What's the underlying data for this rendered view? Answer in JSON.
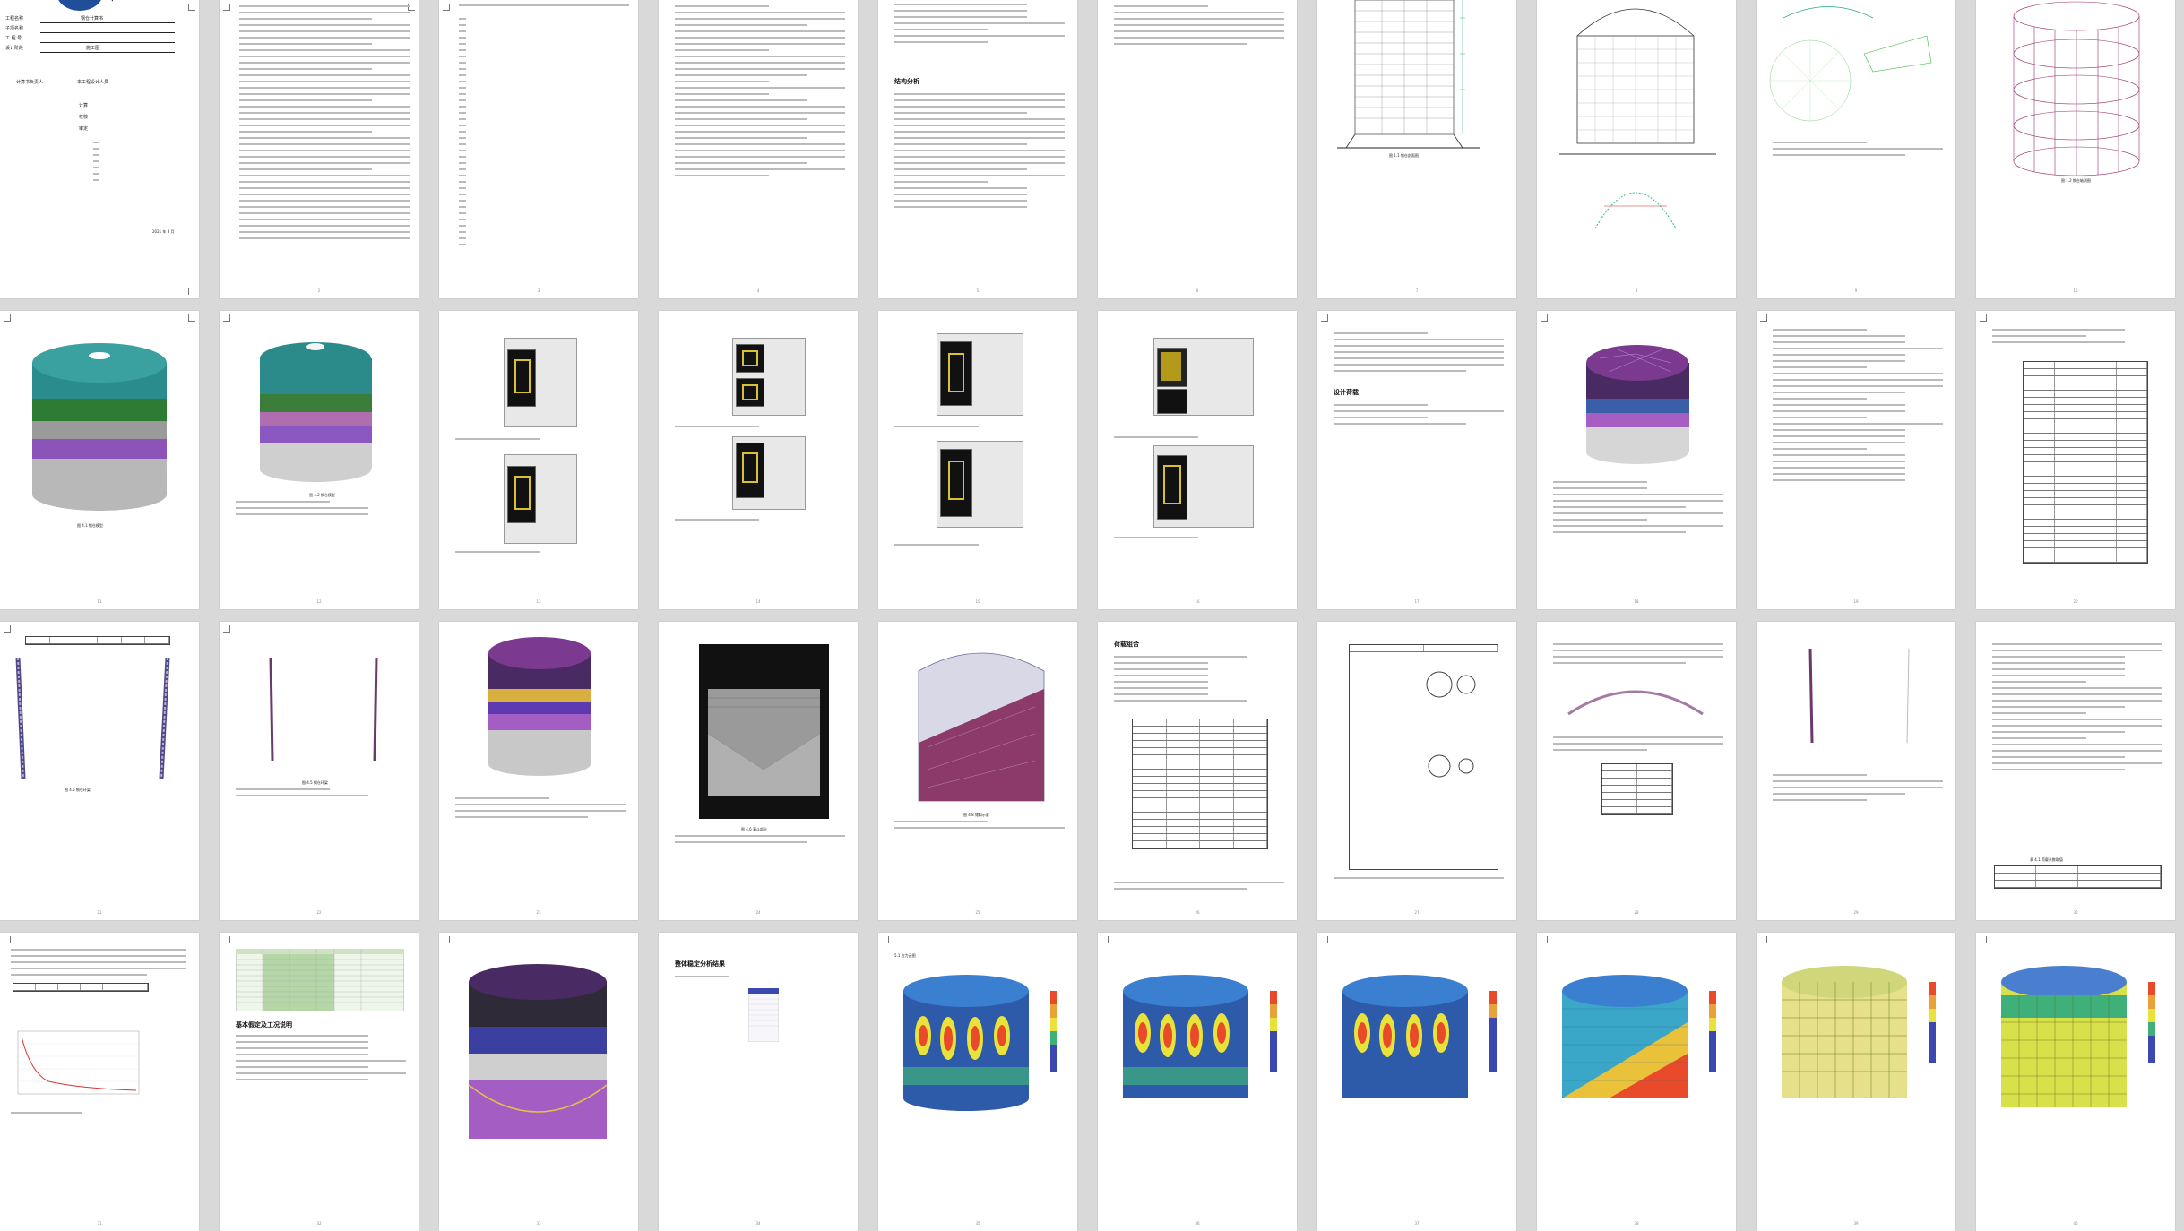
{
  "cover": {
    "logo_fragment": "书",
    "fields": [
      {
        "label": "工程名称",
        "value": "钢仓计算书"
      },
      {
        "label": "子项名称",
        "value": ""
      },
      {
        "label": "工 程 号",
        "value": ""
      },
      {
        "label": "设计阶段",
        "value": "施工图"
      }
    ],
    "sign_title": "计算书负责人",
    "sign_name": "本工程设计人员",
    "roles": [
      "计算",
      "校核",
      "审定"
    ],
    "date": "2021 年 8 月"
  },
  "captions": {
    "cross_section": "图 1.1 钢仓剖面图",
    "model_3d": "图 1.2 钢仓轴测图",
    "render_a": "图 4.1 钢仓模型",
    "render_b": "图 4.2 钢仓模型",
    "section_1": "设计荷载",
    "section_2": "结构分析",
    "section_3": "荷载组合",
    "section_4": "基本假定及工况说明",
    "section_5": "整体稳定分析结果",
    "ring": "图 4.5 钢仓环梁",
    "hopper": "图 4.6 漏斗部分",
    "fill": "图 4.8 储料示意",
    "table_title": "表 4.1 荷载系数取值",
    "curve": "图 4.9 荷载曲线",
    "fem_title": "5.1 应力云图"
  },
  "pages": {
    "numbers": [
      "1",
      "2",
      "3",
      "4",
      "5",
      "6",
      "7",
      "8",
      "9",
      "10",
      "11",
      "12",
      "13",
      "14",
      "15",
      "16",
      "17",
      "18",
      "19",
      "20",
      "21",
      "22",
      "23",
      "24",
      "25",
      "26",
      "27",
      "28",
      "29",
      "30",
      "31",
      "32",
      "33",
      "34",
      "35",
      "36",
      "37",
      "38",
      "39",
      "40"
    ]
  }
}
